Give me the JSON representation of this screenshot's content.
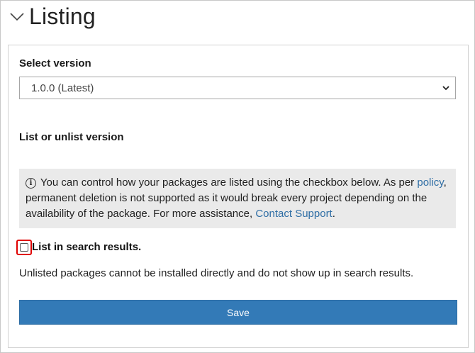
{
  "header": {
    "title": "Listing",
    "toggle_icon": "chevron-down-icon"
  },
  "version": {
    "label": "Select version",
    "selected": "1.0.0 (Latest)",
    "caret_icon": "chevron-down-icon"
  },
  "listing": {
    "heading": "List or unlist version",
    "info": {
      "icon": "info-icon",
      "text_1": "You can control how your packages are listed using the checkbox below. As per",
      "policy_link": "policy",
      "text_2": ", permanent deletion is not supported as it would break every project depending on the availability of the package. For more assistance,",
      "support_link": "Contact Support",
      "text_3": "."
    },
    "checkbox": {
      "label": "List in search results.",
      "checked": false,
      "highlight_color": "#e00000"
    },
    "note": "Unlisted packages cannot be installed directly and do not show up in search results.",
    "save_label": "Save"
  },
  "colors": {
    "primary_button": "#337ab7",
    "link": "#2f6ea5",
    "info_background": "#eaeaea"
  }
}
